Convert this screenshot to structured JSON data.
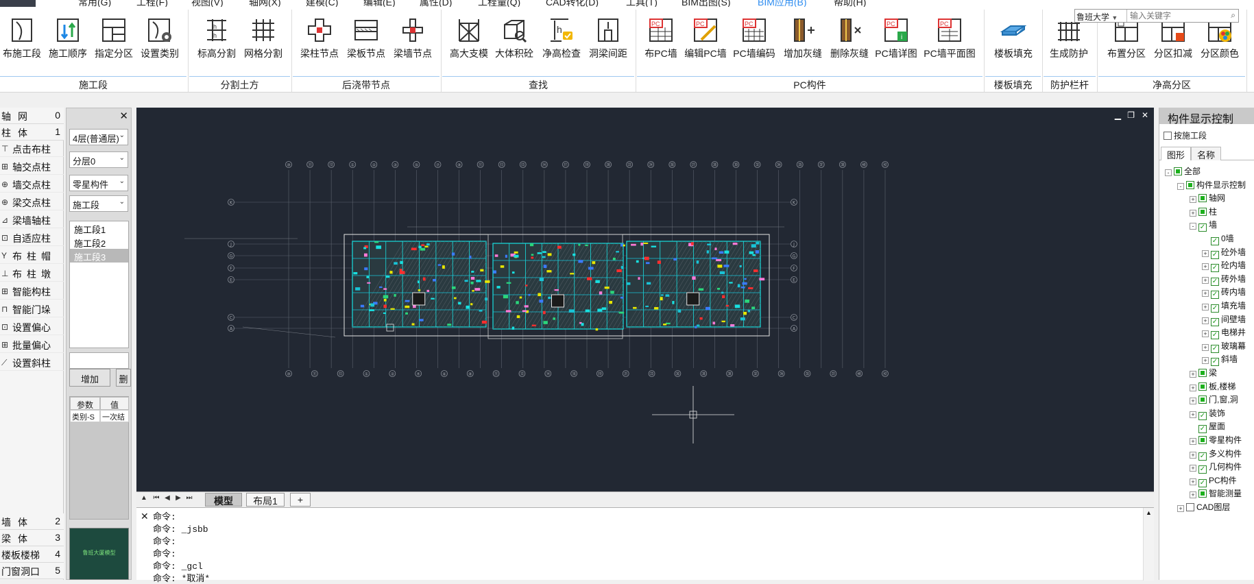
{
  "menu": {
    "items": [
      "常用(G)",
      "工程(F)",
      "视图(V)",
      "轴网(X)",
      "建模(C)",
      "编辑(E)",
      "属性(D)",
      "工程量(Q)",
      "CAD转化(D)",
      "工具(T)",
      "BIM出图(S)",
      "BIM应用(B)",
      "帮助(H)"
    ]
  },
  "ribbon": {
    "buttons": [
      "布施工段",
      "施工顺序",
      "指定分区",
      "设置类别",
      "标高分割",
      "网格分割",
      "梁柱节点",
      "梁板节点",
      "梁墙节点",
      "高大支模",
      "大体积砼",
      "净高检查",
      "洞梁间距",
      "布PC墙",
      "编辑PC墙",
      "PC墙编码",
      "增加灰缝",
      "删除灰缝",
      "PC墙详图",
      "PC墙平面图",
      "楼板填充",
      "生成防护",
      "布置分区",
      "分区扣减",
      "分区颜色"
    ],
    "groups": [
      "施工段",
      "分割土方",
      "后浇带节点",
      "查找",
      "PC构件",
      "楼板填充",
      "防护栏杆",
      "净高分区"
    ]
  },
  "search": {
    "scope": "鲁班大学",
    "placeholder": "输入关键字"
  },
  "left": {
    "cats_top": [
      {
        "name": "轴网",
        "num": "0"
      },
      {
        "name": "柱体",
        "num": "1"
      }
    ],
    "tools": [
      "点击布柱",
      "轴交点柱",
      "墙交点柱",
      "梁交点柱",
      "梁墙轴柱",
      "自适应柱",
      "布柱帽",
      "布柱墩",
      "智能构柱",
      "智能门垛",
      "设置偏心",
      "批量偏心",
      "设置斜柱"
    ],
    "cats_bottom": [
      {
        "name": "墙体",
        "num": "2"
      },
      {
        "name": "梁体",
        "num": "3"
      },
      {
        "name": "楼板楼梯",
        "num": "4"
      },
      {
        "name": "门窗洞口",
        "num": "5"
      }
    ]
  },
  "mid": {
    "floor": "4层(普通层)",
    "sublayer": "分层0",
    "component": "零星构件",
    "mode": "施工段",
    "stages": [
      "施工段1",
      "施工段2",
      "施工段3"
    ],
    "add_label": "增加",
    "del_label": "删",
    "param_headers": [
      "参数",
      "值"
    ],
    "param_row": [
      "类别-S",
      "一次结"
    ],
    "thumb_text": "鲁班大厦模型"
  },
  "cad": {
    "axis_top": [
      "⑩",
      "⑪",
      "⑫",
      "①",
      "②",
      "③",
      "⑤",
      "⑦",
      "⑨",
      "⑪",
      "⑫",
      "⑬",
      "⑭",
      "⑰",
      "⑲",
      "⑳",
      "㉒",
      "㉔",
      "㉖",
      "㉗",
      "㉘",
      "㉚",
      "㉜",
      "㉞",
      "㉟",
      "㊲",
      "㊳",
      "㊵",
      "㊷"
    ],
    "axis_bottom": [
      "⑩",
      "⑪",
      "⑫",
      "①",
      "②",
      "④",
      "⑥",
      "⑧",
      "⑪",
      "⑬",
      "⑭",
      "⑯",
      "⑲",
      "㉑",
      "㉓",
      "㉖",
      "㉘",
      "㉚",
      "㉜",
      "㉞",
      "㉟",
      "㊲",
      "㊵",
      "㊷"
    ],
    "axis_rows": [
      "K",
      "J",
      "G",
      "F",
      "E",
      "C",
      "A"
    ]
  },
  "tabs": {
    "model": "模型",
    "layout1": "布局1",
    "add": "+"
  },
  "cmdline": {
    "lines": [
      "命令:",
      "命令: _jsbb",
      "命令:",
      "命令:",
      "命令: _gcl",
      "命令: *取消*"
    ]
  },
  "right": {
    "title": "构件显示控制",
    "by_stage": "按施工段",
    "tab_graphic": "图形",
    "tab_name": "名称",
    "tree": [
      {
        "label": "全部",
        "level": 0,
        "exp": "-",
        "cb": "fill"
      },
      {
        "label": "构件显示控制",
        "level": 1,
        "exp": "-",
        "cb": "fill"
      },
      {
        "label": "轴网",
        "level": 2,
        "exp": "+",
        "cb": "fill"
      },
      {
        "label": "柱",
        "level": 2,
        "exp": "+",
        "cb": "fill"
      },
      {
        "label": "墙",
        "level": 2,
        "exp": "-",
        "cb": "check"
      },
      {
        "label": "0墙",
        "level": 3,
        "exp": "",
        "cb": "check"
      },
      {
        "label": "砼外墙",
        "level": 3,
        "exp": "+",
        "cb": "check"
      },
      {
        "label": "砼内墙",
        "level": 3,
        "exp": "+",
        "cb": "check"
      },
      {
        "label": "砖外墙",
        "level": 3,
        "exp": "+",
        "cb": "check"
      },
      {
        "label": "砖内墙",
        "level": 3,
        "exp": "+",
        "cb": "check"
      },
      {
        "label": "填充墙",
        "level": 3,
        "exp": "+",
        "cb": "check"
      },
      {
        "label": "间壁墙",
        "level": 3,
        "exp": "+",
        "cb": "check"
      },
      {
        "label": "电梯井",
        "level": 3,
        "exp": "+",
        "cb": "check"
      },
      {
        "label": "玻璃幕",
        "level": 3,
        "exp": "+",
        "cb": "check"
      },
      {
        "label": "斜墙",
        "level": 3,
        "exp": "+",
        "cb": "check"
      },
      {
        "label": "梁",
        "level": 2,
        "exp": "+",
        "cb": "fill"
      },
      {
        "label": "板,楼梯",
        "level": 2,
        "exp": "+",
        "cb": "fill"
      },
      {
        "label": "门,窗,洞",
        "level": 2,
        "exp": "+",
        "cb": "fill"
      },
      {
        "label": "装饰",
        "level": 2,
        "exp": "+",
        "cb": "check"
      },
      {
        "label": "屋面",
        "level": 2,
        "exp": "",
        "cb": "check"
      },
      {
        "label": "零星构件",
        "level": 2,
        "exp": "+",
        "cb": "fill"
      },
      {
        "label": "多义构件",
        "level": 2,
        "exp": "+",
        "cb": "check"
      },
      {
        "label": "几何构件",
        "level": 2,
        "exp": "+",
        "cb": "check"
      },
      {
        "label": "PC构件",
        "level": 2,
        "exp": "+",
        "cb": "check"
      },
      {
        "label": "智能测量",
        "level": 2,
        "exp": "+",
        "cb": "fill"
      },
      {
        "label": "CAD图层",
        "level": 1,
        "exp": "+",
        "cb": "empty"
      }
    ]
  },
  "colors": {
    "cad_bg": "#222833",
    "accent": "#2d8cf0",
    "group_line": "#9ec8f0"
  }
}
